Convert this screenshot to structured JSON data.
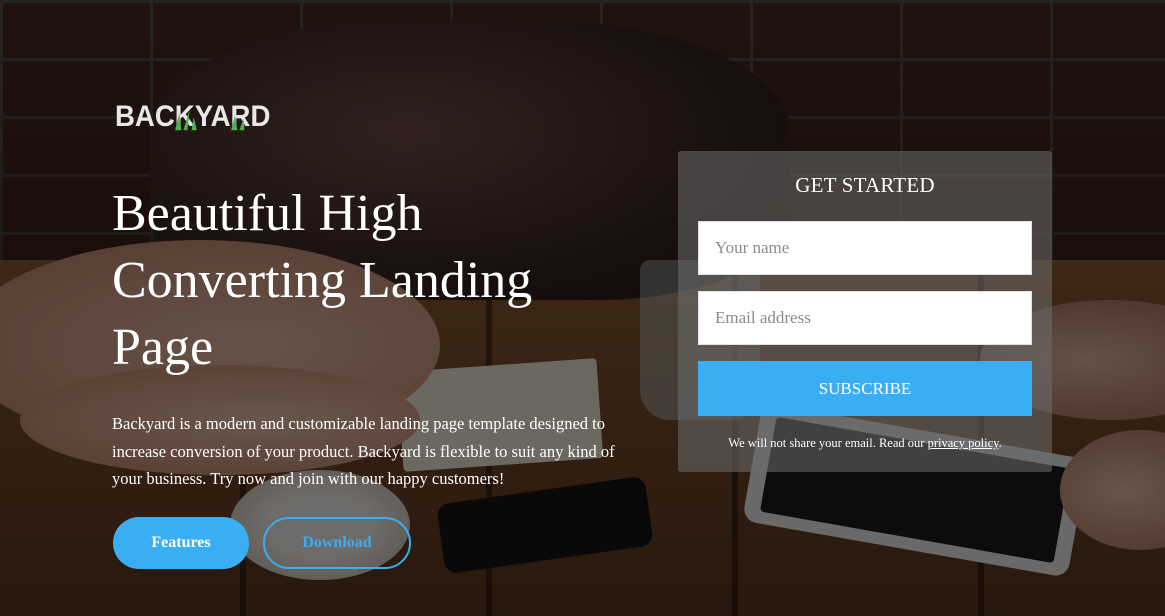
{
  "brand": {
    "logo_text": "BACKYARD"
  },
  "hero": {
    "title": "Beautiful High Converting Landing Page",
    "description": "Backyard is a modern and customizable landing page template designed to increase conversion of your product. Backyard is flexible to suit any kind of your business. Try now and join with our happy customers!",
    "features_button": "Features",
    "download_button": "Download"
  },
  "signup": {
    "title": "GET STARTED",
    "name_placeholder": "Your name",
    "email_placeholder": "Email address",
    "subscribe_button": "SUBSCRIBE",
    "privacy_text": "We will not share your email. Read our",
    "privacy_link": "privacy policy",
    "privacy_suffix": "."
  },
  "colors": {
    "accent": "#3aaef2",
    "panel_bg": "rgba(110,110,110,0.55)",
    "text": "#ffffff"
  }
}
